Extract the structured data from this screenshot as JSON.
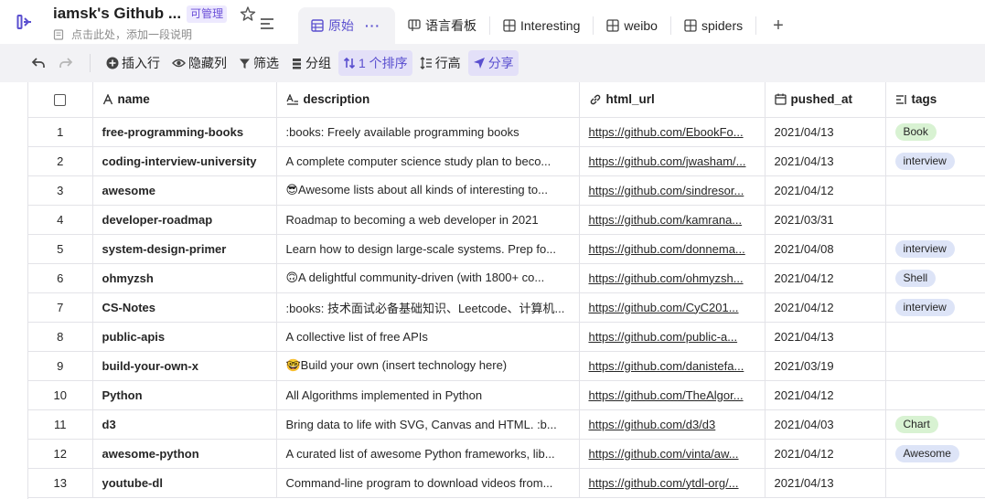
{
  "header": {
    "title": "iamsk's Github ...",
    "badge": "可管理",
    "description": "点击此处，添加一段说明"
  },
  "tabs": [
    {
      "label": "原始",
      "icon": "grid-view-icon",
      "active": true,
      "more": "···"
    },
    {
      "label": "语言看板",
      "icon": "kanban-icon"
    },
    {
      "label": "Interesting",
      "icon": "grid-view-icon"
    },
    {
      "label": "weibo",
      "icon": "grid-view-icon"
    },
    {
      "label": "spiders",
      "icon": "grid-view-icon"
    }
  ],
  "tab_add": "+",
  "toolbar": {
    "insert_row": "插入行",
    "hide_cols": "隐藏列",
    "filter": "筛选",
    "group": "分组",
    "sort": "1 个排序",
    "row_height": "行高",
    "share": "分享"
  },
  "columns": [
    {
      "key": "name",
      "label": "name",
      "icon": "text-icon"
    },
    {
      "key": "description",
      "label": "description",
      "icon": "long-text-icon"
    },
    {
      "key": "html_url",
      "label": "html_url",
      "icon": "link-icon"
    },
    {
      "key": "pushed_at",
      "label": "pushed_at",
      "icon": "calendar-icon"
    },
    {
      "key": "tags",
      "label": "tags",
      "icon": "list-icon"
    }
  ],
  "rows": [
    {
      "idx": "1",
      "name": "free-programming-books",
      "description": ":books: Freely available programming books",
      "html_url": "https://github.com/EbookFo...",
      "pushed_at": "2021/04/13",
      "tag": "Book",
      "tag_color": "green"
    },
    {
      "idx": "2",
      "name": "coding-interview-university",
      "description": "A complete computer science study plan to beco...",
      "html_url": "https://github.com/jwasham/...",
      "pushed_at": "2021/04/13",
      "tag": "interview",
      "tag_color": "blue"
    },
    {
      "idx": "3",
      "name": "awesome",
      "description": "😎Awesome lists about all kinds of interesting to...",
      "html_url": "https://github.com/sindresor...",
      "pushed_at": "2021/04/12",
      "tag": "",
      "tag_color": ""
    },
    {
      "idx": "4",
      "name": "developer-roadmap",
      "description": "Roadmap to becoming a web developer in 2021",
      "html_url": "https://github.com/kamrana...",
      "pushed_at": "2021/03/31",
      "tag": "",
      "tag_color": ""
    },
    {
      "idx": "5",
      "name": "system-design-primer",
      "description": "Learn how to design large-scale systems. Prep fo...",
      "html_url": "https://github.com/donnema...",
      "pushed_at": "2021/04/08",
      "tag": "interview",
      "tag_color": "blue"
    },
    {
      "idx": "6",
      "name": "ohmyzsh",
      "description": "🙃A delightful community-driven (with 1800+ co...",
      "html_url": "https://github.com/ohmyzsh...",
      "pushed_at": "2021/04/12",
      "tag": "Shell",
      "tag_color": "blue"
    },
    {
      "idx": "7",
      "name": "CS-Notes",
      "description": ":books: 技术面试必备基础知识、Leetcode、计算机...",
      "html_url": "https://github.com/CyC201...",
      "pushed_at": "2021/04/12",
      "tag": "interview",
      "tag_color": "blue"
    },
    {
      "idx": "8",
      "name": "public-apis",
      "description": "A collective list of free APIs",
      "html_url": "https://github.com/public-a...",
      "pushed_at": "2021/04/13",
      "tag": "",
      "tag_color": ""
    },
    {
      "idx": "9",
      "name": "build-your-own-x",
      "description": "🤓Build your own (insert technology here)",
      "html_url": "https://github.com/danistefa...",
      "pushed_at": "2021/03/19",
      "tag": "",
      "tag_color": ""
    },
    {
      "idx": "10",
      "name": "Python",
      "description": "All Algorithms implemented in Python",
      "html_url": "https://github.com/TheAlgor...",
      "pushed_at": "2021/04/12",
      "tag": "",
      "tag_color": ""
    },
    {
      "idx": "11",
      "name": "d3",
      "description": "Bring data to life with SVG, Canvas and HTML. :b...",
      "html_url": "https://github.com/d3/d3",
      "pushed_at": "2021/04/03",
      "tag": "Chart",
      "tag_color": "green"
    },
    {
      "idx": "12",
      "name": "awesome-python",
      "description": "A curated list of awesome Python frameworks, lib...",
      "html_url": "https://github.com/vinta/aw...",
      "pushed_at": "2021/04/12",
      "tag": "Awesome",
      "tag_color": "blue"
    },
    {
      "idx": "13",
      "name": "youtube-dl",
      "description": "Command-line program to download videos from...",
      "html_url": "https://github.com/ytdl-org/...",
      "pushed_at": "2021/04/13",
      "tag": "",
      "tag_color": ""
    }
  ]
}
